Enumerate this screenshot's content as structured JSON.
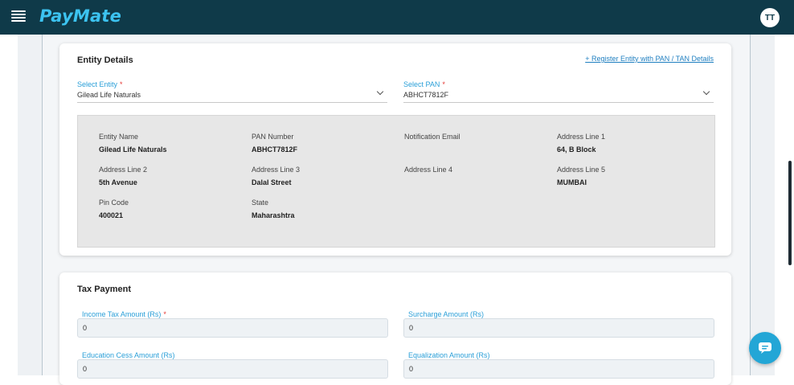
{
  "app": {
    "logo": "PayMate",
    "user_initials": "TT"
  },
  "entity_details": {
    "title": "Entity Details",
    "register_link": "+ Register Entity with PAN / TAN Details",
    "select_entity": {
      "label": "Select Entity",
      "required_mark": "*",
      "value": "Gilead Life Naturals"
    },
    "select_pan": {
      "label": "Select PAN",
      "required_mark": "*",
      "value": "ABHCT7812F"
    },
    "info": [
      {
        "label": "Entity Name",
        "value": "Gilead Life Naturals"
      },
      {
        "label": "PAN Number",
        "value": "ABHCT7812F"
      },
      {
        "label": "Notification Email",
        "value": ""
      },
      {
        "label": "Address Line 1",
        "value": "64, B Block"
      },
      {
        "label": "Address Line 2",
        "value": "5th Avenue"
      },
      {
        "label": "Address Line 3",
        "value": "Dalal Street"
      },
      {
        "label": "Address Line 4",
        "value": ""
      },
      {
        "label": "Address Line 5",
        "value": "MUMBAI"
      },
      {
        "label": "Pin Code",
        "value": "400021"
      },
      {
        "label": "State",
        "value": "Maharashtra"
      }
    ]
  },
  "tax_payment": {
    "title": "Tax Payment",
    "fields": [
      {
        "label": "Income Tax Amount (Rs)",
        "required_mark": "*",
        "value": "0"
      },
      {
        "label": "Surcharge Amount (Rs)",
        "required_mark": "",
        "value": "0"
      },
      {
        "label": "Education Cess Amount (Rs)",
        "required_mark": "",
        "value": "0"
      },
      {
        "label": "Equalization Amount (Rs)",
        "required_mark": "",
        "value": "0"
      }
    ]
  },
  "colors": {
    "header": "#0f3a49",
    "accent": "#2a9fd8",
    "logo": "#3cc3f0",
    "required": "#e53935"
  },
  "icons": {
    "menu": "hamburger-icon",
    "dropdown": "chevron-down-icon",
    "chat": "chat-icon"
  }
}
